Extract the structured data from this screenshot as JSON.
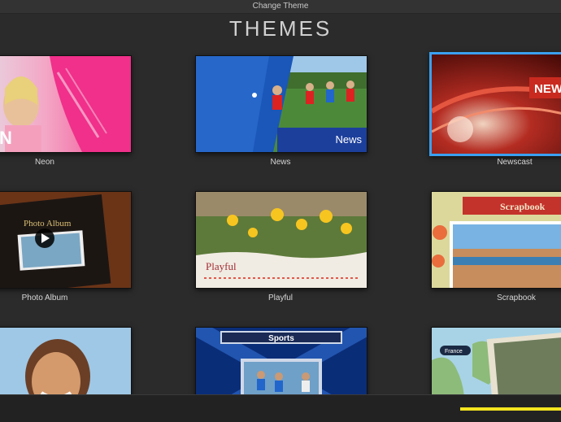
{
  "window": {
    "title": "Change Theme"
  },
  "header": {
    "title": "THEMES"
  },
  "themes": [
    {
      "label": "Neon"
    },
    {
      "label": "News",
      "overlay": "News"
    },
    {
      "label": "Newscast",
      "overlay": "NEW"
    },
    {
      "label": "Photo Album",
      "overlay": "Photo Album"
    },
    {
      "label": "Playful",
      "overlay": "Playful"
    },
    {
      "label": "Scrapbook",
      "overlay": "Scrapbook"
    },
    {
      "label": "",
      "overlay": ""
    },
    {
      "label": "",
      "overlay": "Sports"
    },
    {
      "label": "",
      "overlay": "France"
    }
  ],
  "selected_theme": "Newscast",
  "colors": {
    "selection": "#3aa0f0",
    "progress": "#f3e51f"
  }
}
